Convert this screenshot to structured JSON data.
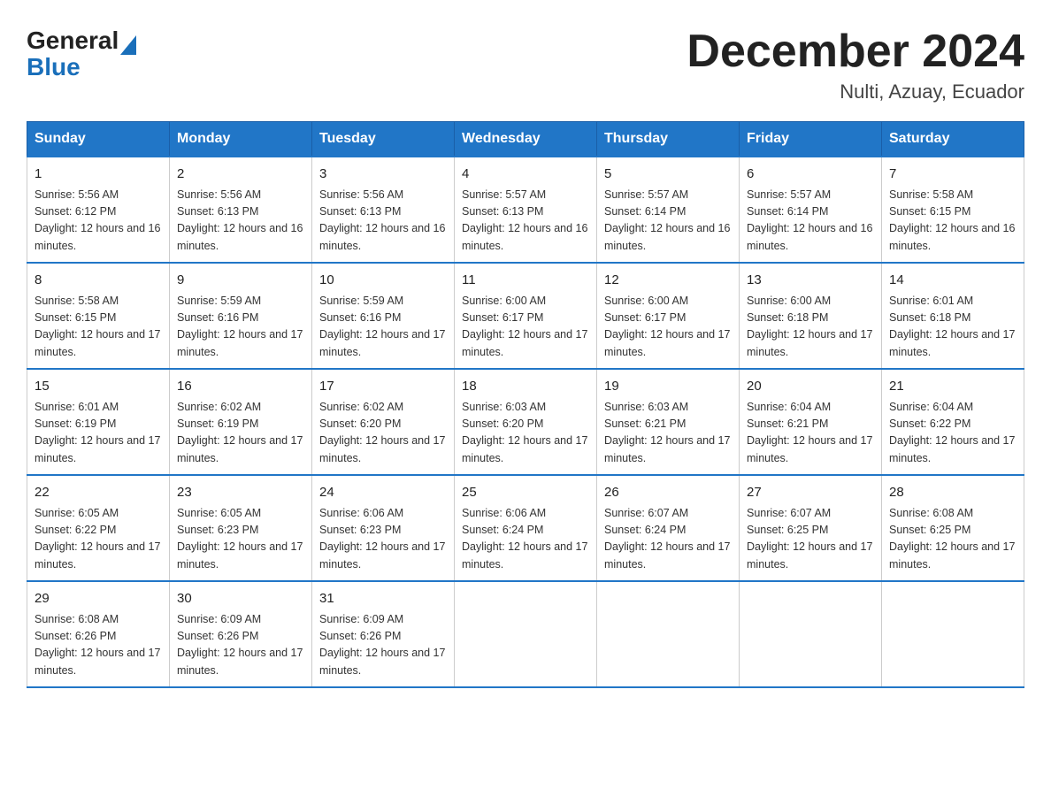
{
  "logo": {
    "general": "General",
    "blue": "Blue",
    "arrow": "▲"
  },
  "header": {
    "month_year": "December 2024",
    "location": "Nulti, Azuay, Ecuador"
  },
  "weekdays": [
    "Sunday",
    "Monday",
    "Tuesday",
    "Wednesday",
    "Thursday",
    "Friday",
    "Saturday"
  ],
  "weeks": [
    [
      {
        "day": "1",
        "sunrise": "5:56 AM",
        "sunset": "6:12 PM",
        "daylight": "12 hours and 16 minutes."
      },
      {
        "day": "2",
        "sunrise": "5:56 AM",
        "sunset": "6:13 PM",
        "daylight": "12 hours and 16 minutes."
      },
      {
        "day": "3",
        "sunrise": "5:56 AM",
        "sunset": "6:13 PM",
        "daylight": "12 hours and 16 minutes."
      },
      {
        "day": "4",
        "sunrise": "5:57 AM",
        "sunset": "6:13 PM",
        "daylight": "12 hours and 16 minutes."
      },
      {
        "day": "5",
        "sunrise": "5:57 AM",
        "sunset": "6:14 PM",
        "daylight": "12 hours and 16 minutes."
      },
      {
        "day": "6",
        "sunrise": "5:57 AM",
        "sunset": "6:14 PM",
        "daylight": "12 hours and 16 minutes."
      },
      {
        "day": "7",
        "sunrise": "5:58 AM",
        "sunset": "6:15 PM",
        "daylight": "12 hours and 16 minutes."
      }
    ],
    [
      {
        "day": "8",
        "sunrise": "5:58 AM",
        "sunset": "6:15 PM",
        "daylight": "12 hours and 17 minutes."
      },
      {
        "day": "9",
        "sunrise": "5:59 AM",
        "sunset": "6:16 PM",
        "daylight": "12 hours and 17 minutes."
      },
      {
        "day": "10",
        "sunrise": "5:59 AM",
        "sunset": "6:16 PM",
        "daylight": "12 hours and 17 minutes."
      },
      {
        "day": "11",
        "sunrise": "6:00 AM",
        "sunset": "6:17 PM",
        "daylight": "12 hours and 17 minutes."
      },
      {
        "day": "12",
        "sunrise": "6:00 AM",
        "sunset": "6:17 PM",
        "daylight": "12 hours and 17 minutes."
      },
      {
        "day": "13",
        "sunrise": "6:00 AM",
        "sunset": "6:18 PM",
        "daylight": "12 hours and 17 minutes."
      },
      {
        "day": "14",
        "sunrise": "6:01 AM",
        "sunset": "6:18 PM",
        "daylight": "12 hours and 17 minutes."
      }
    ],
    [
      {
        "day": "15",
        "sunrise": "6:01 AM",
        "sunset": "6:19 PM",
        "daylight": "12 hours and 17 minutes."
      },
      {
        "day": "16",
        "sunrise": "6:02 AM",
        "sunset": "6:19 PM",
        "daylight": "12 hours and 17 minutes."
      },
      {
        "day": "17",
        "sunrise": "6:02 AM",
        "sunset": "6:20 PM",
        "daylight": "12 hours and 17 minutes."
      },
      {
        "day": "18",
        "sunrise": "6:03 AM",
        "sunset": "6:20 PM",
        "daylight": "12 hours and 17 minutes."
      },
      {
        "day": "19",
        "sunrise": "6:03 AM",
        "sunset": "6:21 PM",
        "daylight": "12 hours and 17 minutes."
      },
      {
        "day": "20",
        "sunrise": "6:04 AM",
        "sunset": "6:21 PM",
        "daylight": "12 hours and 17 minutes."
      },
      {
        "day": "21",
        "sunrise": "6:04 AM",
        "sunset": "6:22 PM",
        "daylight": "12 hours and 17 minutes."
      }
    ],
    [
      {
        "day": "22",
        "sunrise": "6:05 AM",
        "sunset": "6:22 PM",
        "daylight": "12 hours and 17 minutes."
      },
      {
        "day": "23",
        "sunrise": "6:05 AM",
        "sunset": "6:23 PM",
        "daylight": "12 hours and 17 minutes."
      },
      {
        "day": "24",
        "sunrise": "6:06 AM",
        "sunset": "6:23 PM",
        "daylight": "12 hours and 17 minutes."
      },
      {
        "day": "25",
        "sunrise": "6:06 AM",
        "sunset": "6:24 PM",
        "daylight": "12 hours and 17 minutes."
      },
      {
        "day": "26",
        "sunrise": "6:07 AM",
        "sunset": "6:24 PM",
        "daylight": "12 hours and 17 minutes."
      },
      {
        "day": "27",
        "sunrise": "6:07 AM",
        "sunset": "6:25 PM",
        "daylight": "12 hours and 17 minutes."
      },
      {
        "day": "28",
        "sunrise": "6:08 AM",
        "sunset": "6:25 PM",
        "daylight": "12 hours and 17 minutes."
      }
    ],
    [
      {
        "day": "29",
        "sunrise": "6:08 AM",
        "sunset": "6:26 PM",
        "daylight": "12 hours and 17 minutes."
      },
      {
        "day": "30",
        "sunrise": "6:09 AM",
        "sunset": "6:26 PM",
        "daylight": "12 hours and 17 minutes."
      },
      {
        "day": "31",
        "sunrise": "6:09 AM",
        "sunset": "6:26 PM",
        "daylight": "12 hours and 17 minutes."
      },
      null,
      null,
      null,
      null
    ]
  ]
}
